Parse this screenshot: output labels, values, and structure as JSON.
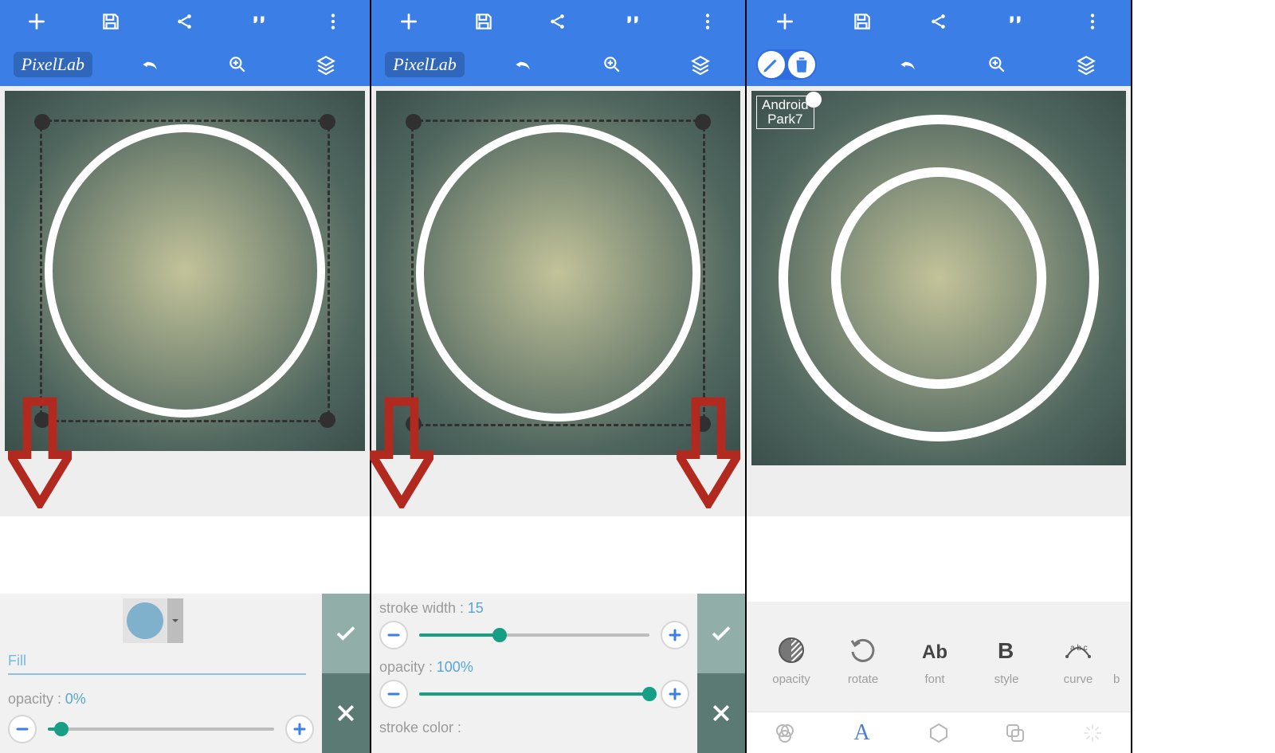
{
  "app": {
    "logo": "PixelLab"
  },
  "panelA": {
    "fill_label": "Fill",
    "opacity_label": "opacity :",
    "opacity_value": "0%",
    "slider_pct": 6
  },
  "panelB": {
    "stroke_width_label": "stroke width :",
    "stroke_width_value": "15",
    "stroke_width_pct": 35,
    "opacity_label": "opacity :",
    "opacity_value": "100%",
    "opacity_pct": 100,
    "stroke_color_label": "stroke color :"
  },
  "panelC": {
    "text_sel_l1": "Android",
    "text_sel_l2": "Park7",
    "tools": {
      "opacity": "opacity",
      "rotate": "rotate",
      "font": "font",
      "style": "style",
      "curve": "curve",
      "background": "backgro"
    }
  }
}
